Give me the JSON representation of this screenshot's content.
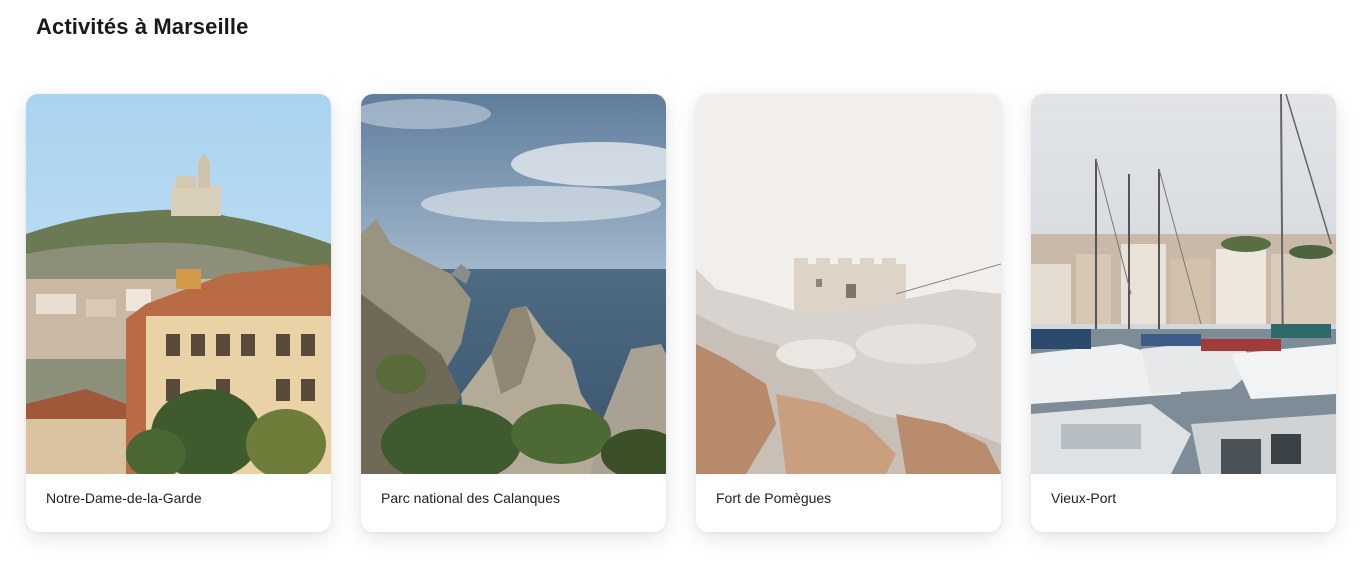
{
  "page": {
    "title": "Activités à Marseille"
  },
  "activities": [
    {
      "label": "Notre-Dame-de-la-Garde",
      "image": "notre-dame-de-la-garde-photo"
    },
    {
      "label": "Parc national des Calanques",
      "image": "calanques-photo"
    },
    {
      "label": "Fort de Pomègues",
      "image": "fort-de-pomegues-photo"
    },
    {
      "label": "Vieux-Port",
      "image": "vieux-port-photo"
    }
  ]
}
